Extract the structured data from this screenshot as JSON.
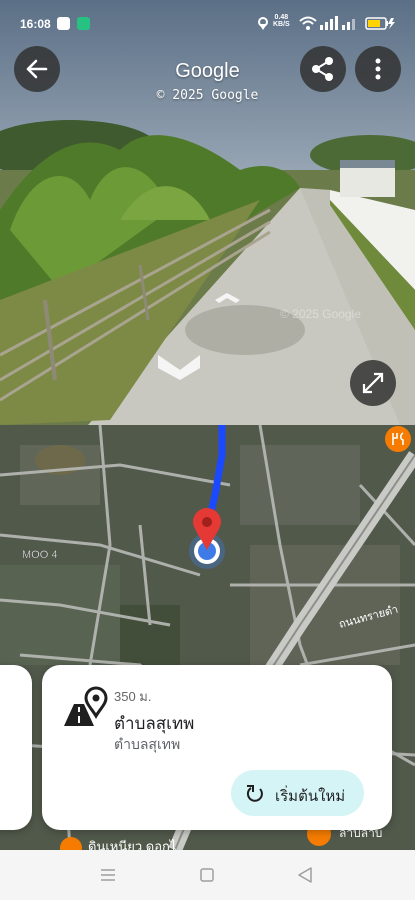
{
  "status_bar": {
    "time": "16:08",
    "net_speed_value": "0.48",
    "net_speed_unit": "KB/S"
  },
  "street_view": {
    "title": "Google",
    "copyright": "© 2025 Google",
    "watermark": "© 2025 Google"
  },
  "map": {
    "area_label": "MOO 4",
    "road_label": "ถนนทรายดำ",
    "poi_label": "ดินเหนียว ดอกไ",
    "bottom_right_label": "ลาบลาบ"
  },
  "card": {
    "distance": "350 ม.",
    "title": "ตำบลสุเทพ",
    "subtitle": "ตำบลสุเทพ",
    "restart_label": "เริ่มต้นใหม่"
  },
  "icons": {
    "back": "arrow-left-icon",
    "share": "share-icon",
    "more": "more-vert-icon",
    "expand": "expand-diagonal-icon",
    "pin": "red-pin-icon",
    "restart": "restart-icon",
    "streetview": "road-pin-icon",
    "restaurant": "fork-knife-icon"
  },
  "colors": {
    "route": "#1a49ff",
    "pin": "#e53935",
    "restart_bg": "#d5f4f6",
    "poi": "#f57c00"
  }
}
